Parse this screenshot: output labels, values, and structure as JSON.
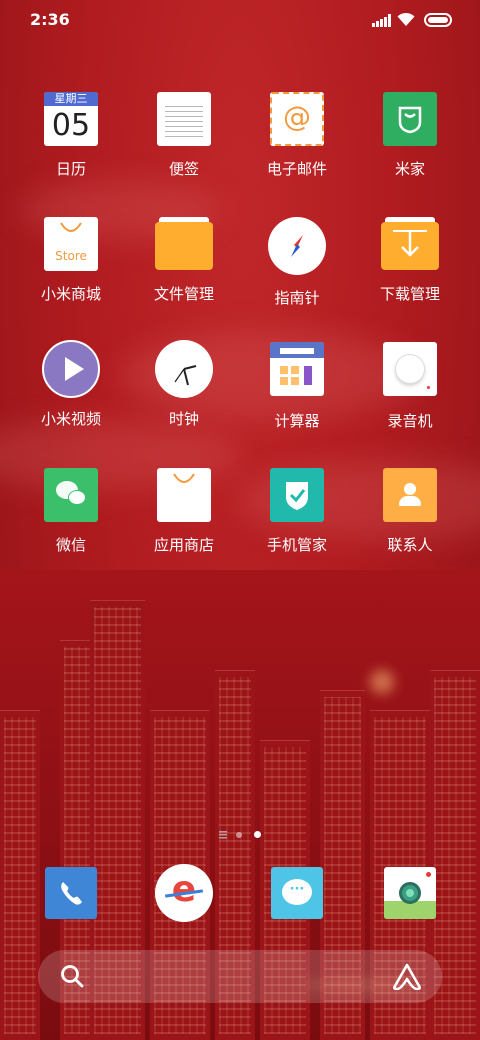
{
  "status_bar": {
    "time": "2:36"
  },
  "apps": [
    {
      "label": "日历",
      "icon": "calendar-icon",
      "weekday": "星期三",
      "day": "05"
    },
    {
      "label": "便签",
      "icon": "notes-icon"
    },
    {
      "label": "电子邮件",
      "icon": "email-icon",
      "glyph": "@"
    },
    {
      "label": "米家",
      "icon": "mijia-icon"
    },
    {
      "label": "小米商城",
      "icon": "mi-store-icon",
      "caption": "Store"
    },
    {
      "label": "文件管理",
      "icon": "file-manager-icon"
    },
    {
      "label": "指南针",
      "icon": "compass-icon"
    },
    {
      "label": "下载管理",
      "icon": "downloads-icon"
    },
    {
      "label": "小米视频",
      "icon": "video-icon"
    },
    {
      "label": "时钟",
      "icon": "clock-icon"
    },
    {
      "label": "计算器",
      "icon": "calculator-icon"
    },
    {
      "label": "录音机",
      "icon": "recorder-icon"
    },
    {
      "label": "微信",
      "icon": "wechat-icon"
    },
    {
      "label": "应用商店",
      "icon": "app-store-icon"
    },
    {
      "label": "手机管家",
      "icon": "security-icon"
    },
    {
      "label": "联系人",
      "icon": "contacts-icon"
    }
  ],
  "dock": [
    {
      "icon": "phone-icon"
    },
    {
      "icon": "browser-icon",
      "glyph": "e"
    },
    {
      "icon": "messages-icon",
      "glyph": "···"
    },
    {
      "icon": "camera-icon"
    }
  ],
  "colors": {
    "wallpaper": "#b11c20",
    "calendar_header": "#4f6bd0",
    "mijia": "#2fae62",
    "folder": "#ffad2e",
    "video": "#8a78c2",
    "wechat": "#3cbf6a",
    "security": "#22b9ad",
    "contacts": "#ffae45",
    "phone": "#3f86d6",
    "messages": "#4ec4e6"
  }
}
